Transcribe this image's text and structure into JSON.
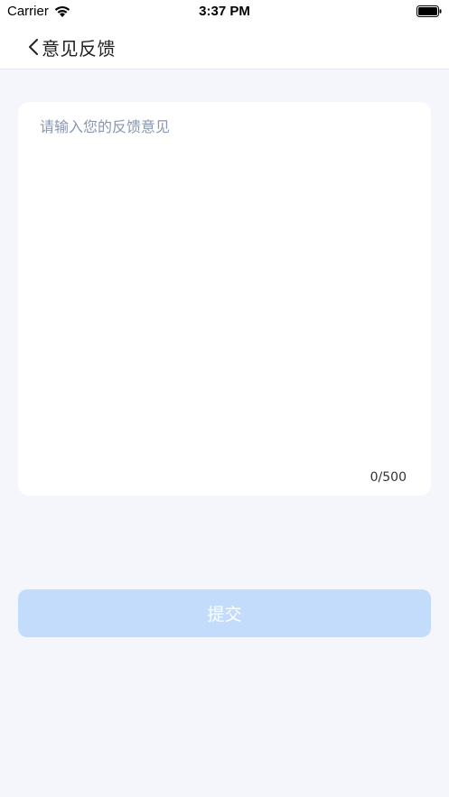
{
  "status_bar": {
    "carrier": "Carrier",
    "time": "3:37 PM"
  },
  "nav": {
    "title": "意见反馈",
    "back_icon": "chevron-left-icon"
  },
  "feedback": {
    "placeholder": "请输入您的反馈意见",
    "value": "",
    "counter": "0/500"
  },
  "submit": {
    "label": "提交",
    "color": "#c4dcfc"
  }
}
